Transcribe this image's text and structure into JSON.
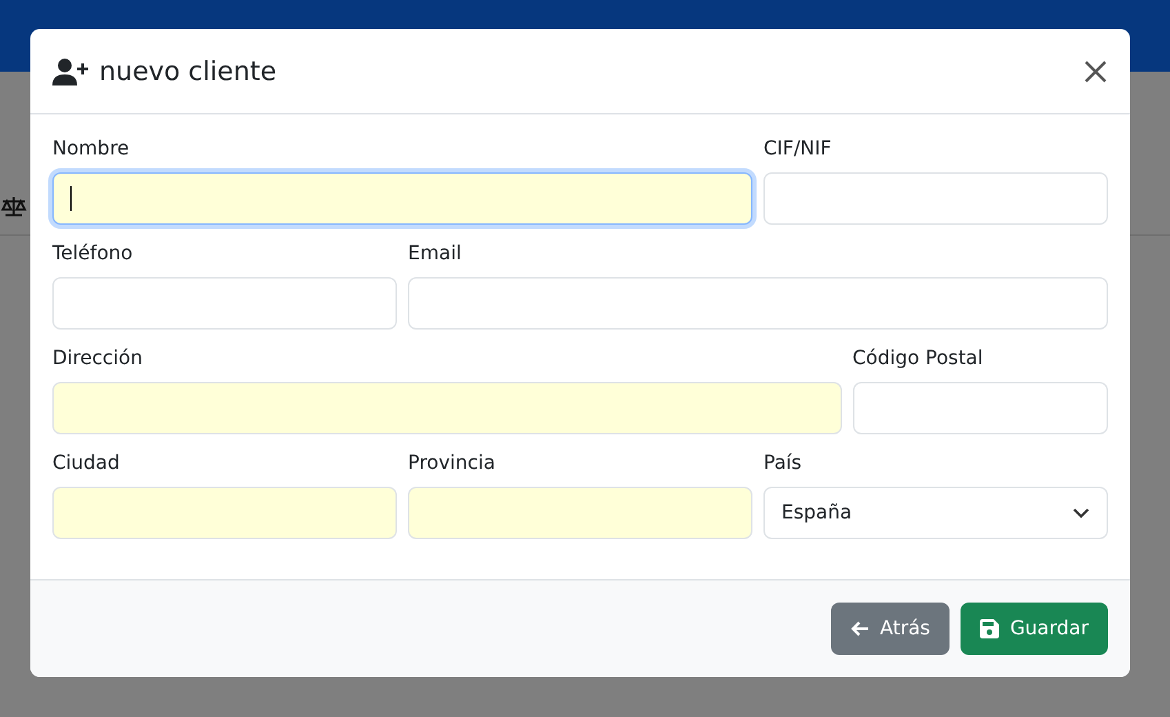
{
  "dialog": {
    "title": "nuevo cliente",
    "fields": [
      {
        "label": "Nombre",
        "kind": "text",
        "required": true,
        "focused": true
      },
      {
        "label": "CIF/NIF",
        "kind": "text",
        "required": false,
        "focused": false
      },
      {
        "label": "Teléfono",
        "kind": "text",
        "required": false,
        "focused": false
      },
      {
        "label": "Email",
        "kind": "text",
        "required": false,
        "focused": false
      },
      {
        "label": "Dirección",
        "kind": "text",
        "required": true,
        "focused": false
      },
      {
        "label": "Código Postal",
        "kind": "text",
        "required": false,
        "focused": false
      },
      {
        "label": "Ciudad",
        "kind": "text",
        "required": true,
        "focused": false
      },
      {
        "label": "Provincia",
        "kind": "text",
        "required": true,
        "focused": false
      },
      {
        "label": "País",
        "kind": "select",
        "value": "España",
        "required": false,
        "focused": false
      }
    ],
    "buttons": [
      {
        "label": "Atrás",
        "kind": "back"
      },
      {
        "label": "Guardar",
        "kind": "save"
      }
    ]
  }
}
